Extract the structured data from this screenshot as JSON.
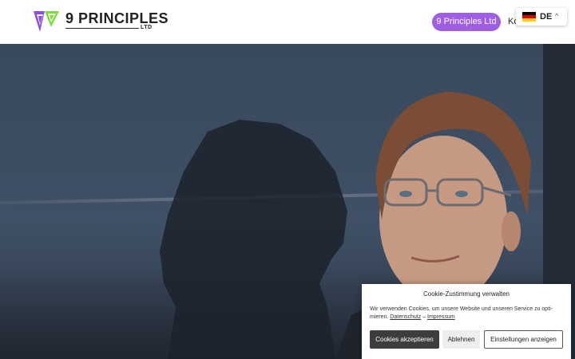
{
  "header": {
    "logo_text": "9 PRINCIPLES",
    "logo_sub": "LTD",
    "nav_pill_label": "9 Principles Ltd",
    "nav_link_label": "Ko",
    "language": {
      "label": "DE",
      "flag_icon": "germany-flag-icon",
      "chevron_icon": "chevron-up-icon"
    }
  },
  "hero": {
    "image_name": "portrait-photo"
  },
  "cookie": {
    "title": "Cookie-Zustimmung verwalten",
    "text": "Wir verwenden Cookies, um unsere Website und unseren Service zu opti-mieren.",
    "link_privacy": "Datenschutz",
    "separator": "–",
    "link_imprint": "Impressum",
    "accept_label": "Cookies akzeptieren",
    "deny_label": "Ablehnen",
    "settings_label": "Einstellungen anzeigen"
  },
  "colors": {
    "accent_purple": "#a05ee6",
    "logo_green": "#7ddc3a",
    "logo_purple": "#8a4fe0",
    "button_dark": "#3d3d3d"
  }
}
